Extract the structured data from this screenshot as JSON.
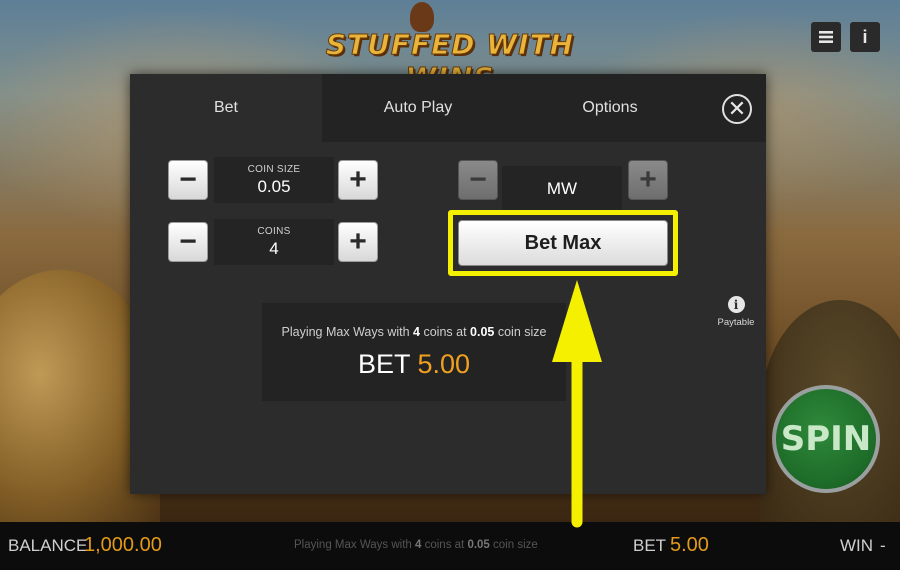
{
  "game": {
    "logo_text": "STUFFED WITH WINS",
    "menu_icon": "hamburger-menu-icon",
    "info_icon": "info-icon",
    "info_glyph": "i",
    "spin_label": "SPIN"
  },
  "modal": {
    "tabs": [
      {
        "label": "Bet",
        "active": true
      },
      {
        "label": "Auto Play",
        "active": false
      },
      {
        "label": "Options",
        "active": false
      }
    ],
    "close_glyph": "✕",
    "coin_size": {
      "label": "COIN SIZE",
      "value": "0.05"
    },
    "coins": {
      "label": "COINS",
      "value": "4"
    },
    "ways": {
      "value": "MW"
    },
    "minus_glyph": "−",
    "plus_glyph": "+",
    "bet_max_label": "Bet Max",
    "summary": {
      "prefix": "Playing Max Ways with ",
      "coins": "4",
      "middle": " coins at ",
      "coin_size": "0.05",
      "suffix": " coin size",
      "bet_label": "BET",
      "bet_value": "5.00"
    },
    "paytable": {
      "glyph": "i",
      "label": "Paytable"
    }
  },
  "bottom_bar": {
    "balance_label": "BALANCE",
    "balance_value": "1,000.00",
    "info_prefix": "Playing Max Ways with ",
    "info_coins": "4",
    "info_middle": " coins at ",
    "info_coin_size": "0.05",
    "info_suffix": " coin size",
    "bet_label": "BET",
    "bet_value": "5.00",
    "win_label": "WIN",
    "win_value": "-"
  },
  "colors": {
    "highlight": "#f4f000",
    "accent": "#f0a020",
    "modal_bg": "#2c2c2c"
  }
}
